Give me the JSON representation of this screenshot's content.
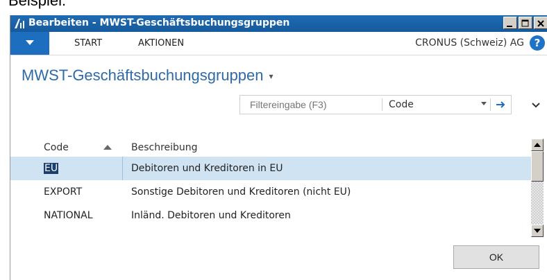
{
  "caption": "Beispiel:",
  "window": {
    "title": "Bearbeiten - MWST-Geschäftsbuchungsgruppen"
  },
  "ribbon": {
    "tabs": [
      "START",
      "AKTIONEN"
    ],
    "company": "CRONUS (Schweiz) AG",
    "help": "?"
  },
  "page": {
    "title": "MWST-Geschäftsbuchungsgruppen"
  },
  "filter": {
    "placeholder": "Filtereingabe (F3)",
    "field": "Code"
  },
  "table": {
    "headers": {
      "code": "Code",
      "description": "Beschreibung"
    },
    "rows": [
      {
        "code": "EU",
        "description": "Debitoren und Kreditoren in EU",
        "selected": true
      },
      {
        "code": "EXPORT",
        "description": "Sonstige Debitoren und Kreditoren (nicht EU)",
        "selected": false
      },
      {
        "code": "NATIONAL",
        "description": "Inländ. Debitoren und Kreditoren",
        "selected": false
      }
    ]
  },
  "buttons": {
    "ok": "OK"
  },
  "colors": {
    "titlebar": "#155a9c",
    "accent": "#1e6ebf",
    "page_title": "#2f6aa8",
    "selected_row": "#cfe3f3"
  }
}
